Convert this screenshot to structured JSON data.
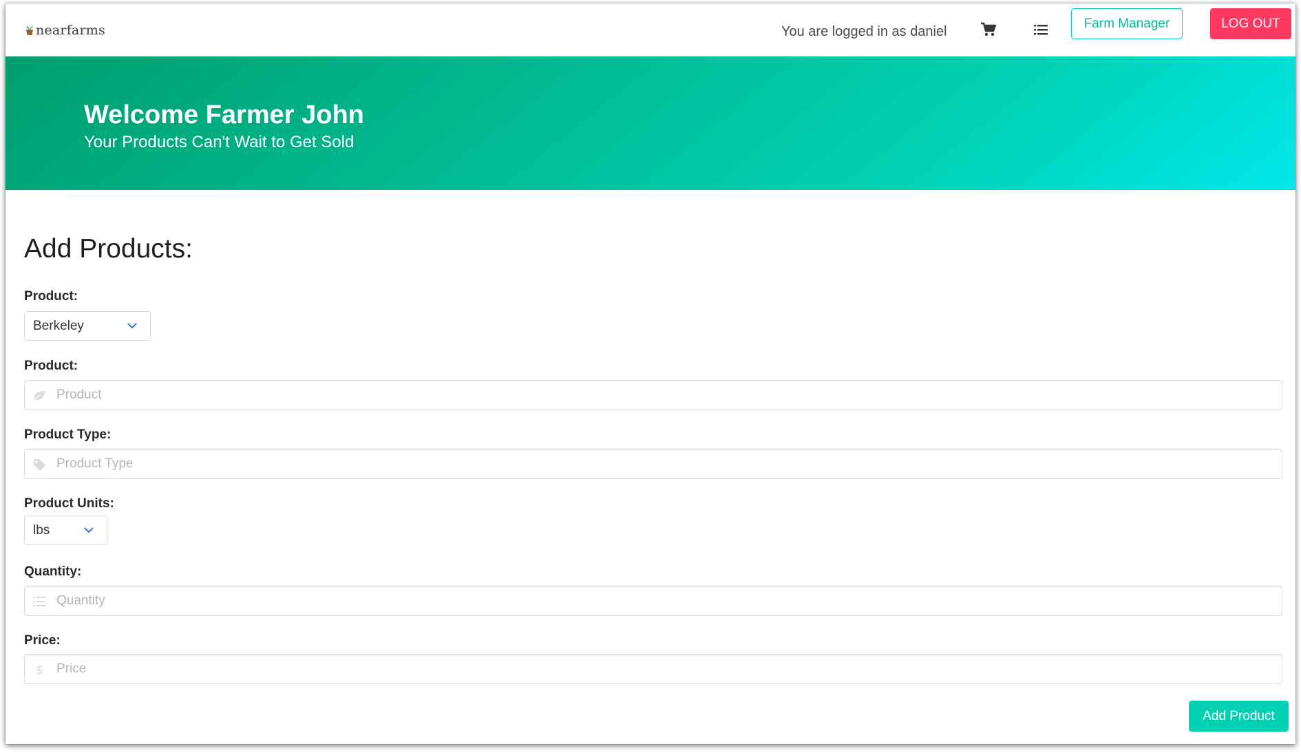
{
  "brand": {
    "name": "nearfarms"
  },
  "navbar": {
    "login_text": "You are logged in as daniel",
    "farm_manager_label": "Farm Manager",
    "logout_label": "LOG OUT"
  },
  "hero": {
    "title": "Welcome Farmer John",
    "subtitle": "Your Products Can't Wait to Get Sold"
  },
  "form": {
    "title": "Add Products:",
    "farm_select": {
      "label": "Product:",
      "value": "Berkeley"
    },
    "product": {
      "label": "Product:",
      "placeholder": "Product"
    },
    "product_type": {
      "label": "Product Type:",
      "placeholder": "Product Type"
    },
    "units": {
      "label": "Product Units:",
      "value": "lbs"
    },
    "quantity": {
      "label": "Quantity:",
      "placeholder": "Quantity"
    },
    "price": {
      "label": "Price:",
      "placeholder": "Price"
    },
    "submit_label": "Add Product"
  },
  "colors": {
    "primary": "#00d1b2",
    "danger": "#ff3860",
    "hero_start": "#009e6c",
    "hero_end": "#00e7eb"
  },
  "icons": [
    "logo-icon",
    "cart-icon",
    "list-icon",
    "leaf-icon",
    "tag-icon",
    "list-icon",
    "dollar-icon",
    "chevron-down-icon"
  ]
}
